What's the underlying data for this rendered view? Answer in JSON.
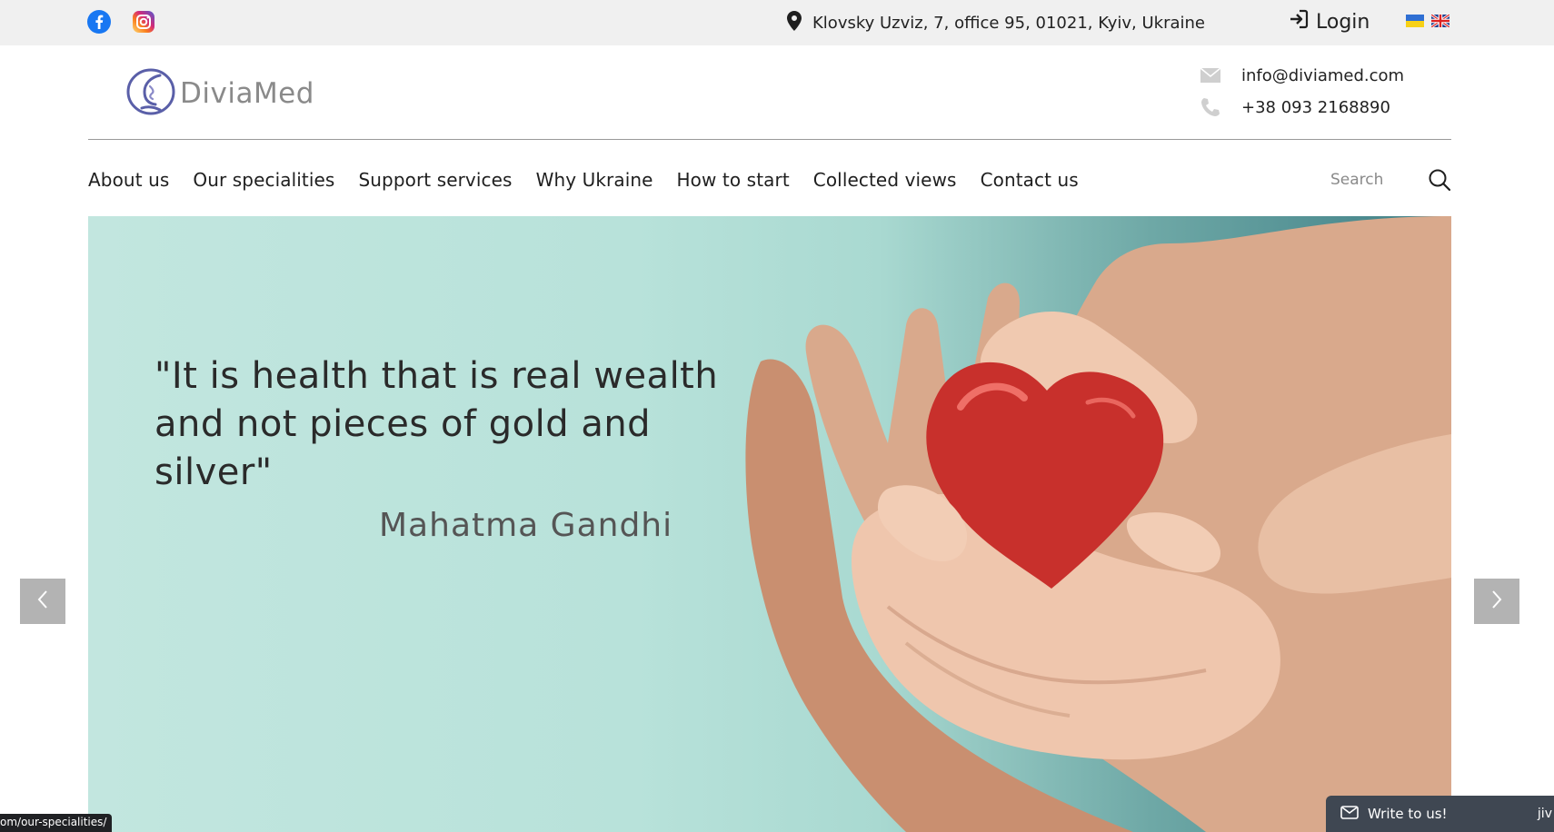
{
  "topbar": {
    "address": "Klovsky Uzviz, 7, office 95, 01021, Kyiv, Ukraine",
    "login_label": "Login",
    "social": [
      "facebook-icon",
      "instagram-icon"
    ],
    "languages": [
      "ua",
      "en"
    ]
  },
  "header": {
    "logo_text": "DiviaMed",
    "email": "info@diviamed.com",
    "phone": "+38 093 2168890"
  },
  "nav": {
    "items": [
      "About us",
      "Our specialities",
      "Support services",
      "Why Ukraine",
      "How to start",
      "Collected views",
      "Contact us"
    ],
    "search_placeholder": "Search"
  },
  "hero": {
    "quote": "\"It is health that is real wealth and not pieces of gold and silver\"",
    "author": "Mahatma Gandhi"
  },
  "chat": {
    "label": "Write to us!",
    "brand": "jiv"
  },
  "status_url": "om/our-specialities/",
  "colors": {
    "topbar_bg": "#f0f0f0",
    "hero_teal": "#b8e2da",
    "heart_red": "#c8302c",
    "logo_blue": "#5a5fa8",
    "chat_bg": "#3f4752"
  }
}
